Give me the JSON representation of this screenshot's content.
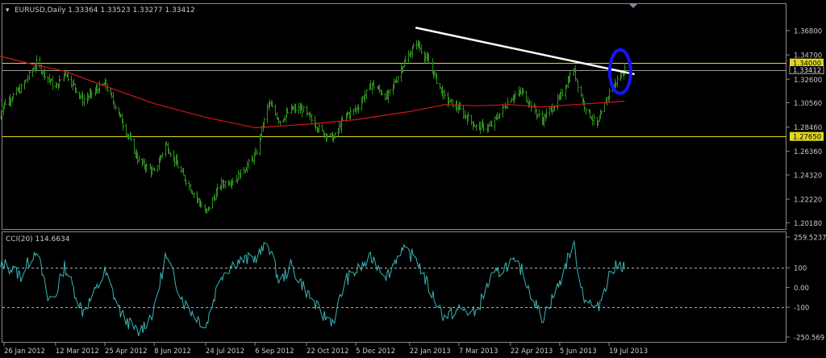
{
  "window": {
    "menu_glyph": "▾",
    "header": "EURUSD,Daily  1.33364 1.33523 1.33277 1.33412"
  },
  "colors": {
    "background": "#000000",
    "candles": "#2e8b1e",
    "ma": "#d21818",
    "levels": "#e0d820",
    "trendline": "#ffffff",
    "highlight": "#1414ff",
    "cci": "#3ab4b4",
    "axis_text": "#c8c8c8"
  },
  "chart_data": [
    {
      "type": "bar",
      "subtype": "ohlc",
      "title": "EURUSD,Daily",
      "ohlc": {
        "open": 1.33364,
        "high": 1.33523,
        "low": 1.33277,
        "close": 1.33412
      },
      "y_ticks": [
        "1.36800",
        "1.34700",
        "1.32600",
        "1.30560",
        "1.28460",
        "1.26360",
        "1.24320",
        "1.22220",
        "1.20180"
      ],
      "ylim": [
        1.1985,
        1.3785
      ],
      "x_ticks": [
        "26 Jan 2012",
        "12 Mar 2012",
        "25 Apr 2012",
        "8 Jun 2012",
        "24 Jul 2012",
        "6 Sep 2012",
        "22 Oct 2012",
        "5 Dec 2012",
        "22 Jan 2013",
        "7 Mar 2013",
        "22 Apr 2013",
        "5 Jun 2013",
        "19 Jul 2013"
      ],
      "price_path": [
        [
          "2012-01-20",
          1.293
        ],
        [
          "2012-01-26",
          1.305
        ],
        [
          "2012-02-10",
          1.318
        ],
        [
          "2012-02-24",
          1.34
        ],
        [
          "2012-03-12",
          1.318
        ],
        [
          "2012-03-20",
          1.333
        ],
        [
          "2012-04-05",
          1.308
        ],
        [
          "2012-04-25",
          1.322
        ],
        [
          "2012-05-10",
          1.29
        ],
        [
          "2012-05-25",
          1.255
        ],
        [
          "2012-06-08",
          1.245
        ],
        [
          "2012-06-18",
          1.27
        ],
        [
          "2012-07-05",
          1.24
        ],
        [
          "2012-07-24",
          1.21
        ],
        [
          "2012-08-06",
          1.235
        ],
        [
          "2012-08-20",
          1.24
        ],
        [
          "2012-09-06",
          1.26
        ],
        [
          "2012-09-18",
          1.305
        ],
        [
          "2012-09-28",
          1.29
        ],
        [
          "2012-10-08",
          1.3
        ],
        [
          "2012-10-18",
          1.3
        ],
        [
          "2012-10-22",
          1.295
        ],
        [
          "2012-11-05",
          1.28
        ],
        [
          "2012-11-15",
          1.275
        ],
        [
          "2012-11-26",
          1.295
        ],
        [
          "2012-12-05",
          1.3
        ],
        [
          "2012-12-19",
          1.322
        ],
        [
          "2013-01-02",
          1.31
        ],
        [
          "2013-01-14",
          1.335
        ],
        [
          "2013-01-28",
          1.358
        ],
        [
          "2013-02-08",
          1.34
        ],
        [
          "2013-02-22",
          1.31
        ],
        [
          "2013-03-07",
          1.3
        ],
        [
          "2013-03-22",
          1.285
        ],
        [
          "2013-04-04",
          1.285
        ],
        [
          "2013-04-22",
          1.31
        ],
        [
          "2013-05-02",
          1.315
        ],
        [
          "2013-05-20",
          1.29
        ],
        [
          "2013-06-05",
          1.31
        ],
        [
          "2013-06-17",
          1.335
        ],
        [
          "2013-06-26",
          1.305
        ],
        [
          "2013-07-08",
          1.285
        ],
        [
          "2013-07-19",
          1.315
        ],
        [
          "2013-07-26",
          1.325
        ],
        [
          "2013-08-02",
          1.334
        ]
      ],
      "ma_path": [
        [
          "2012-01-02",
          1.352
        ],
        [
          "2012-01-26",
          1.345
        ],
        [
          "2012-02-24",
          1.338
        ],
        [
          "2012-03-20",
          1.333
        ],
        [
          "2012-04-25",
          1.32
        ],
        [
          "2012-06-08",
          1.305
        ],
        [
          "2012-07-24",
          1.293
        ],
        [
          "2012-09-06",
          1.284
        ],
        [
          "2012-10-22",
          1.287
        ],
        [
          "2012-12-05",
          1.291
        ],
        [
          "2013-01-22",
          1.298
        ],
        [
          "2013-02-22",
          1.304
        ],
        [
          "2013-03-22",
          1.303
        ],
        [
          "2013-04-22",
          1.304
        ],
        [
          "2013-05-20",
          1.302
        ],
        [
          "2013-06-17",
          1.304
        ],
        [
          "2013-07-19",
          1.306
        ],
        [
          "2013-08-02",
          1.307
        ]
      ],
      "ma_period": "",
      "horizontal_levels": [
        {
          "price": 1.34,
          "label": "1.34000"
        },
        {
          "price": 1.2765,
          "label": "1.27650"
        }
      ],
      "current_price": {
        "price": 1.33412,
        "label": "1.33412"
      },
      "trendline": {
        "from": [
          "2013-01-28",
          1.3705
        ],
        "to": [
          "2013-08-10",
          1.3305
        ]
      },
      "highlight_ellipse_center": [
        "2013-07-29",
        1.3325
      ]
    },
    {
      "type": "line",
      "title": "CCI(20) 114.6634",
      "series": [
        {
          "name": "CCI(20)",
          "value": 114.6634
        }
      ],
      "y_ticks": [
        "259.5237",
        "100",
        "0.00",
        "-100",
        "-250.569"
      ],
      "ylim": [
        -250.569,
        259.5237
      ],
      "levels": [
        100,
        -100
      ],
      "cci_path": [
        [
          "2012-01-20",
          80
        ],
        [
          "2012-01-26",
          120
        ],
        [
          "2012-02-10",
          60
        ],
        [
          "2012-02-24",
          200
        ],
        [
          "2012-03-05",
          -60
        ],
        [
          "2012-03-12",
          -40
        ],
        [
          "2012-03-20",
          110
        ],
        [
          "2012-04-05",
          -120
        ],
        [
          "2012-04-15",
          -40
        ],
        [
          "2012-04-25",
          80
        ],
        [
          "2012-05-10",
          -140
        ],
        [
          "2012-05-25",
          -230
        ],
        [
          "2012-06-08",
          -120
        ],
        [
          "2012-06-18",
          160
        ],
        [
          "2012-07-05",
          -80
        ],
        [
          "2012-07-24",
          -200
        ],
        [
          "2012-08-06",
          60
        ],
        [
          "2012-08-20",
          130
        ],
        [
          "2012-09-06",
          150
        ],
        [
          "2012-09-18",
          220
        ],
        [
          "2012-09-28",
          20
        ],
        [
          "2012-10-08",
          110
        ],
        [
          "2012-10-22",
          -20
        ],
        [
          "2012-11-05",
          -140
        ],
        [
          "2012-11-15",
          -170
        ],
        [
          "2012-11-26",
          40
        ],
        [
          "2012-12-05",
          80
        ],
        [
          "2012-12-19",
          150
        ],
        [
          "2013-01-02",
          60
        ],
        [
          "2013-01-14",
          190
        ],
        [
          "2013-01-28",
          150
        ],
        [
          "2013-02-08",
          0
        ],
        [
          "2013-02-22",
          -150
        ],
        [
          "2013-03-07",
          -110
        ],
        [
          "2013-03-22",
          -130
        ],
        [
          "2013-04-04",
          40
        ],
        [
          "2013-04-22",
          130
        ],
        [
          "2013-05-02",
          90
        ],
        [
          "2013-05-20",
          -160
        ],
        [
          "2013-06-05",
          20
        ],
        [
          "2013-06-17",
          230
        ],
        [
          "2013-06-26",
          -40
        ],
        [
          "2013-07-08",
          -120
        ],
        [
          "2013-07-19",
          60
        ],
        [
          "2013-07-26",
          110
        ],
        [
          "2013-08-02",
          115
        ]
      ]
    }
  ]
}
